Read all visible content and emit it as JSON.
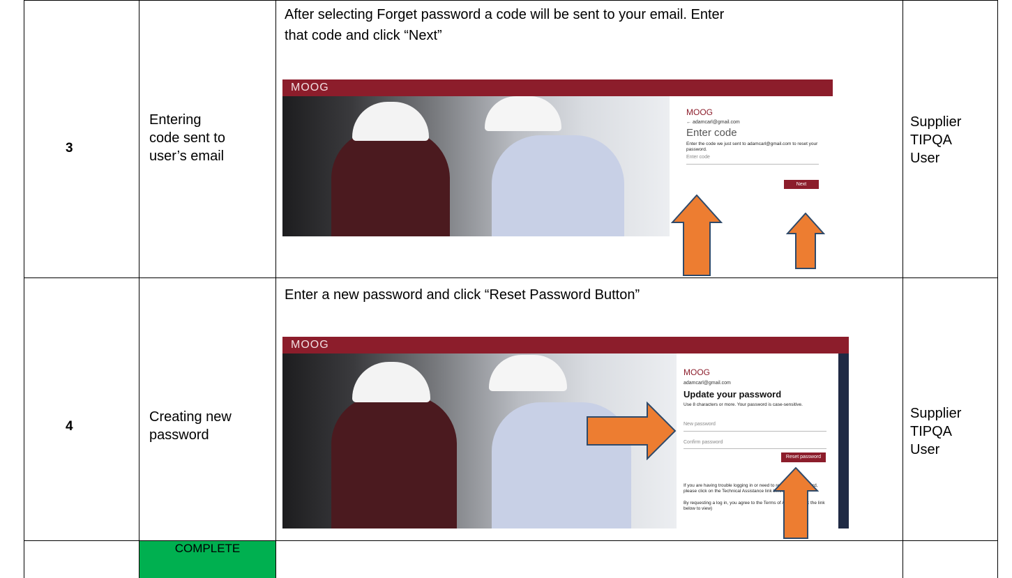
{
  "rows": [
    {
      "number": "3",
      "title_lines": [
        "Entering",
        "code sent to",
        "user’s email"
      ],
      "instruction_lines": [
        "After selecting Forget password a code will be sent to your email. Enter",
        "that code and click “Next”"
      ],
      "role_lines": [
        "Supplier",
        "TIPQA",
        "User"
      ],
      "screen": {
        "brand": "MOOG",
        "panel_brand": "MOOG",
        "email": "← adamcarl@gmail.com",
        "heading": "Enter code",
        "description": "Enter the code we just sent to adamcarl@gmail.com to reset your password.",
        "code_placeholder": "Enter code",
        "next_label": "Next"
      }
    },
    {
      "number": "4",
      "title_lines": [
        "Creating new",
        "password"
      ],
      "instruction_lines": [
        "Enter a new password and click “Reset Password Button”"
      ],
      "role_lines": [
        "Supplier",
        "TIPQA",
        "User"
      ],
      "screen": {
        "brand": "MOOG",
        "panel_brand": "MOOG",
        "email": "adamcarl@gmail.com",
        "heading": "Update your password",
        "description": "Use 8 characters or more. Your password is case-sensitive.",
        "new_password_placeholder": "New password",
        "confirm_password_placeholder": "Confirm password",
        "reset_label": "Reset password",
        "help_text": "If you are having trouble logging in or need to reset your password, please click on the Technical Assistance link below.",
        "terms_text": "By requesting a log in, you agree to the Terms of Access (Click the link below to view)"
      }
    }
  ],
  "footer_status": "COMPLETE",
  "colors": {
    "brand": "#8c1d2b",
    "arrow": "#ed7d31",
    "arrow_outline": "#2f4a6a",
    "status": "#00b050"
  }
}
